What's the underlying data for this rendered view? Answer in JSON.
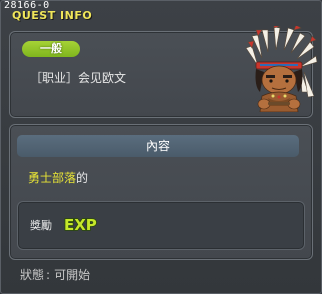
{
  "window": {
    "quest_id": "28166-0",
    "title": "QUEST INFO"
  },
  "quest": {
    "category": "一般",
    "name": "［职业］会见欧文",
    "portrait_icon": "native-chief-portrait-icon"
  },
  "content": {
    "header": "內容",
    "npc_name": "勇士部落",
    "suffix": "的"
  },
  "reward": {
    "label": "獎勵",
    "exp_icon_text": "EXP",
    "exp_icon": "exp-icon"
  },
  "status": {
    "label": "狀態",
    "separator": ":",
    "value": "可開始"
  },
  "colors": {
    "title": "#f0e65a",
    "category_badge": "#8cc21f",
    "npc_highlight": "#e8e436",
    "exp": "#c6e82a"
  }
}
